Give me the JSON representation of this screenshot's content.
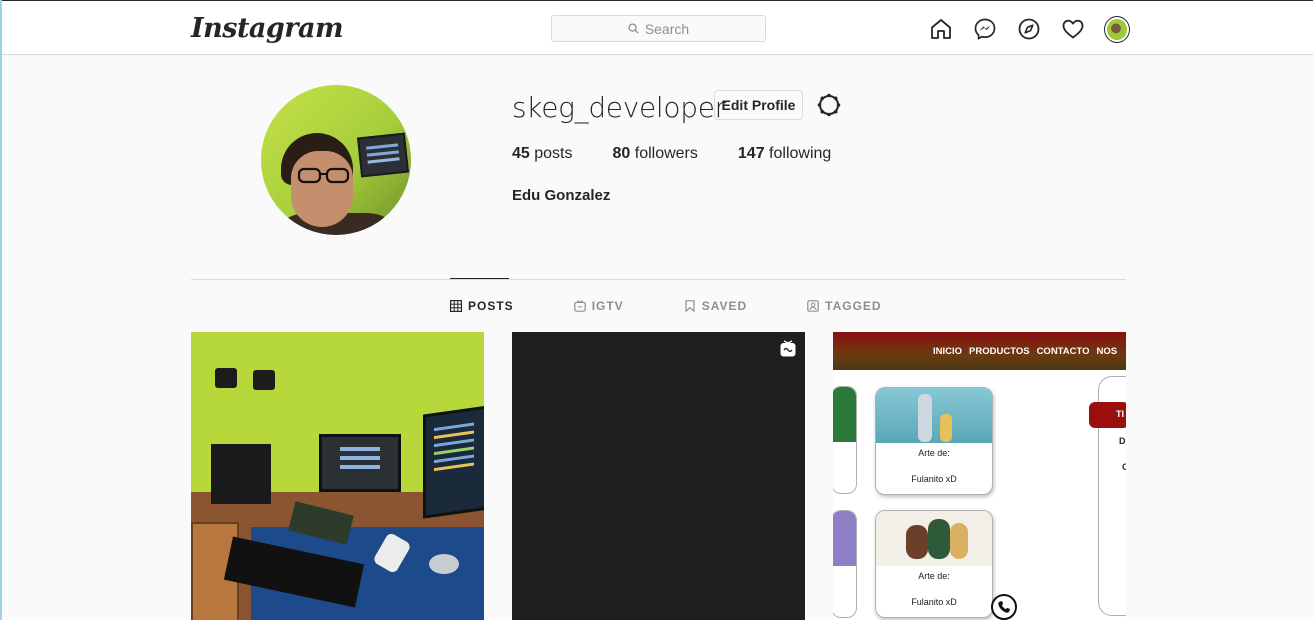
{
  "nav": {
    "logo": "Instagram",
    "search_placeholder": "Search",
    "icons": [
      "home-icon",
      "messenger-icon",
      "explore-icon",
      "heart-icon",
      "profile-avatar"
    ]
  },
  "profile": {
    "username": "skeg_developer",
    "edit_button": "Edit Profile",
    "posts_count": "45",
    "posts_label": "posts",
    "followers_count": "80",
    "followers_label": "followers",
    "following_count": "147",
    "following_label": "following",
    "full_name": "Edu Gonzalez"
  },
  "tabs": [
    {
      "label": "POSTS",
      "icon": "grid-icon",
      "active": true
    },
    {
      "label": "IGTV",
      "icon": "igtv-icon",
      "active": false
    },
    {
      "label": "SAVED",
      "icon": "bookmark-icon",
      "active": false
    },
    {
      "label": "TAGGED",
      "icon": "tagged-icon",
      "active": false
    }
  ],
  "posts": [
    {
      "kind": "photo",
      "description": "desk setup"
    },
    {
      "kind": "reel",
      "badge_icon": "reel-icon"
    },
    {
      "kind": "screenshot",
      "menu": [
        "INICIO",
        "PRODUCTOS",
        "CONTACTO",
        "NOS"
      ],
      "cards": [
        {
          "line1": "Arte de:",
          "line2": "Fulanito xD"
        },
        {
          "line1": "Arte de:",
          "line2": "Fulanito xD"
        }
      ],
      "tab_text": "TI",
      "side_letters": [
        "D",
        "C"
      ]
    }
  ],
  "colors": {
    "background": "#fafafa",
    "border": "#dbdbdb",
    "text": "#262626",
    "muted": "#8e8e8e"
  }
}
